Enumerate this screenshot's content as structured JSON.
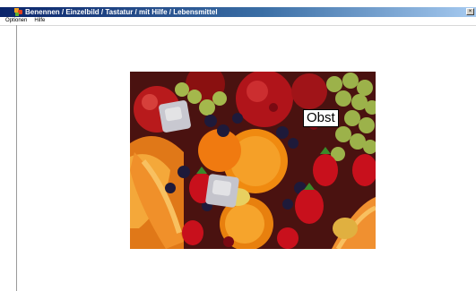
{
  "window": {
    "title": "Benennen / Einzelbild / Tastatur / mit Hilfe / Lebensmittel",
    "app_icon": "fruit-app-icon"
  },
  "menubar": {
    "items": [
      "Optionen",
      "Hilfe"
    ]
  },
  "main": {
    "image_icon": "fruit-photo",
    "word_label": "Obst"
  },
  "colors": {
    "titlebar_start": "#0a246a",
    "titlebar_end": "#a6caf0",
    "label_bg": "#ffffff"
  }
}
